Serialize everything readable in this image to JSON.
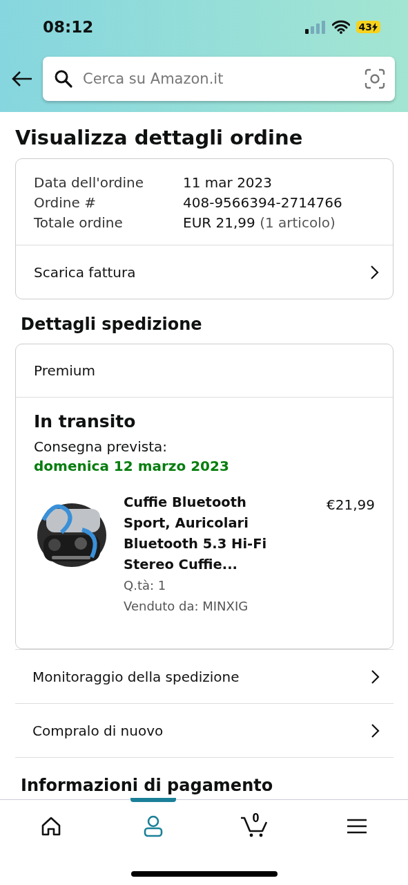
{
  "status_bar": {
    "time": "08:12",
    "battery": "43"
  },
  "search": {
    "placeholder": "Cerca su Amazon.it"
  },
  "title": "Visualizza dettagli ordine",
  "order_summary": {
    "rows": [
      {
        "label": "Data dell'ordine",
        "value": "11 mar 2023"
      },
      {
        "label": "Ordine #",
        "value": "408-9566394-2714766"
      },
      {
        "label": "Totale ordine",
        "value": "EUR 21,99",
        "note": "(1 articolo)"
      }
    ],
    "invoice_link": "Scarica fattura"
  },
  "shipment_heading": "Dettagli spedizione",
  "shipment": {
    "service": "Premium",
    "status": "In transito",
    "delivery_label": "Consegna prevista:",
    "delivery_date": "domenica 12 marzo 2023",
    "item": {
      "kind": "picture",
      "title": "Cuffie Bluetooth Sport, Auricolari Bluetooth 5.3 Hi-Fi Stereo Cuffie...",
      "price": "€21,99",
      "quantity": "Q.tà: 1",
      "seller": "Venduto da: MINXIG"
    }
  },
  "actions": [
    "Monitoraggio della spedizione",
    "Compralo di nuovo"
  ],
  "payment_heading": "Informazioni di pagamento",
  "tab_bar": [
    {
      "kind": "home",
      "selected": false
    },
    {
      "kind": "account",
      "selected": true
    },
    {
      "kind": "cart",
      "selected": false,
      "count": "0"
    },
    {
      "kind": "menu",
      "selected": false
    }
  ]
}
